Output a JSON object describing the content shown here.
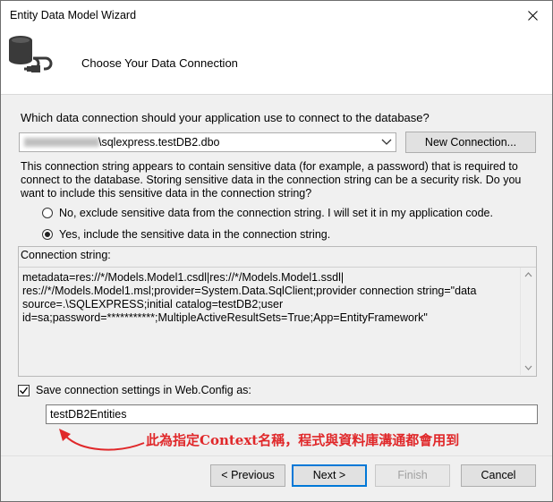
{
  "window": {
    "title": "Entity Data Model Wizard"
  },
  "header": {
    "title": "Choose Your Data Connection"
  },
  "question": "Which data connection should your application use to connect to the database?",
  "connection_select": {
    "value": "\\sqlexpress.testDB2.dbo"
  },
  "new_connection_button": "New Connection...",
  "warning_text": "This connection string appears to contain sensitive data (for example, a password) that is required to connect to the database. Storing sensitive data in the connection string can be a security risk. Do you want to include this sensitive data in the connection string?",
  "radio_options": [
    {
      "label": "No, exclude sensitive data from the connection string. I will set it in my application code.",
      "checked": false
    },
    {
      "label": "Yes, include the sensitive data in the connection string.",
      "checked": true
    }
  ],
  "connection_string_label": "Connection string:",
  "connection_string": "metadata=res://*/Models.Model1.csdl|res://*/Models.Model1.ssdl|\nres://*/Models.Model1.msl;provider=System.Data.SqlClient;provider connection string=\"data\nsource=.\\SQLEXPRESS;initial catalog=testDB2;user\nid=sa;password=***********;MultipleActiveResultSets=True;App=EntityFramework\"",
  "save_settings": {
    "label": "Save connection settings in Web.Config as:",
    "checked": true
  },
  "entity_name": "testDB2Entities",
  "annotation": "此為指定Context名稱，程式與資料庫溝通都會用到",
  "buttons": {
    "previous": "< Previous",
    "next": "Next >",
    "finish": "Finish",
    "cancel": "Cancel"
  },
  "colors": {
    "annotation": "#e0282a",
    "accent": "#0078d7"
  }
}
